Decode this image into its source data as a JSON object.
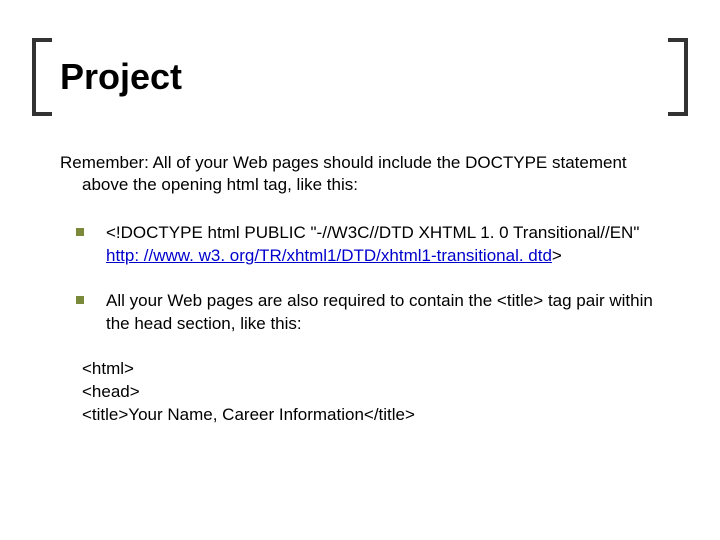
{
  "title": "Project",
  "intro": "Remember: All of your Web pages should include the DOCTYPE statement above the opening html tag, like this:",
  "bullet1_prefix": "<!DOCTYPE html PUBLIC \"-//W3C//DTD XHTML 1. 0 Transitional//EN\" ",
  "bullet1_link": "http: //www. w3. org/TR/xhtml1/DTD/xhtml1-transitional. dtd",
  "bullet1_suffix": ">",
  "bullet2": "All your Web pages are also required to contain the <title> tag pair within the head section, like this:",
  "code1": "<html>",
  "code2": "<head>",
  "code3": "<title>Your Name, Career Information</title>"
}
